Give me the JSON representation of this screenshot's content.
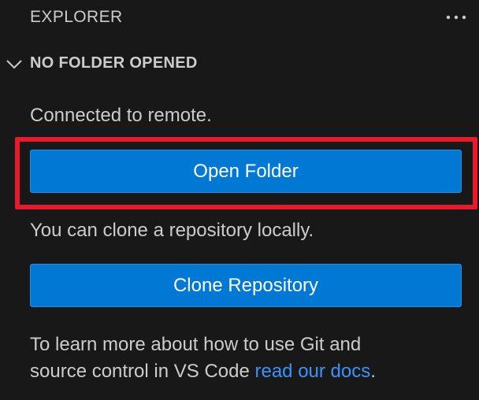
{
  "explorer": {
    "title": "EXPLORER",
    "more_icon": "ellipsis-icon"
  },
  "section": {
    "title": "NO FOLDER OPENED",
    "chevron_icon": "chevron-down-icon"
  },
  "content": {
    "connected_text": "Connected to remote.",
    "open_folder_label": "Open Folder",
    "clone_hint": "You can clone a repository locally.",
    "clone_label": "Clone Repository",
    "learn_line1": "To learn more about how to use Git and",
    "learn_line2_prefix": "source control in VS Code ",
    "learn_link": "read our docs",
    "learn_suffix": "."
  },
  "colors": {
    "background": "#181818",
    "button": "#0078d4",
    "link": "#3794ff",
    "highlight": "#e8192c"
  }
}
